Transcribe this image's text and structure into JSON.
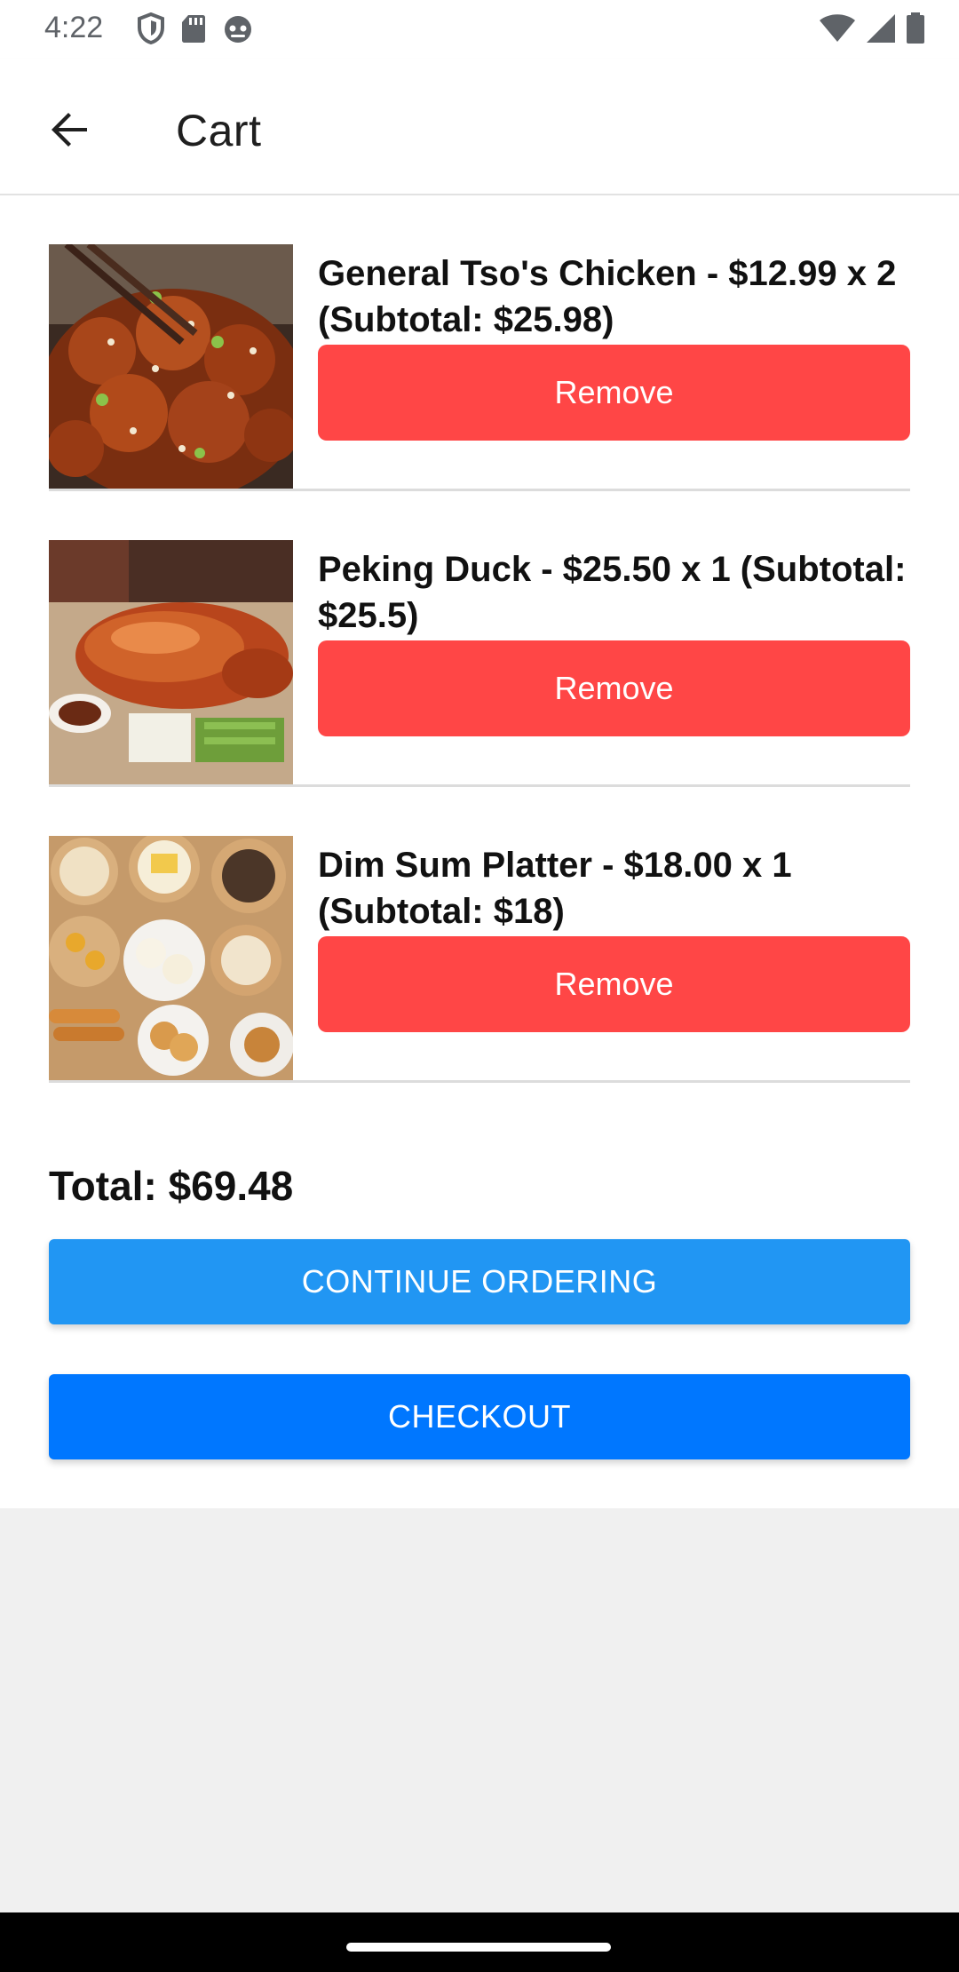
{
  "status_bar": {
    "time": "4:22",
    "icons_left": [
      "shield-icon",
      "sd-card-icon",
      "robot-icon"
    ],
    "icons_right": [
      "wifi-icon",
      "cellular-signal-icon",
      "battery-icon"
    ]
  },
  "app_bar": {
    "title": "Cart",
    "back_icon": "arrow-back-icon"
  },
  "cart": {
    "items": [
      {
        "title": "General Tso's Chicken - $12.99 x 2 (Subtotal: $25.98)",
        "remove_label": "Remove",
        "image": "general-tso-chicken-photo"
      },
      {
        "title": "Peking Duck - $25.50 x 1 (Subtotal: $25.5)",
        "remove_label": "Remove",
        "image": "peking-duck-photo"
      },
      {
        "title": "Dim Sum Platter - $18.00 x 1 (Subtotal: $18)",
        "remove_label": "Remove",
        "image": "dim-sum-platter-photo"
      }
    ],
    "total": "Total: $69.48",
    "continue_label": "CONTINUE ORDERING",
    "checkout_label": "CHECKOUT"
  },
  "colors": {
    "remove_button": "#FF4646",
    "continue_button": "#2196F3",
    "checkout_button": "#0077FF",
    "page_background": "#F0F0F0"
  }
}
